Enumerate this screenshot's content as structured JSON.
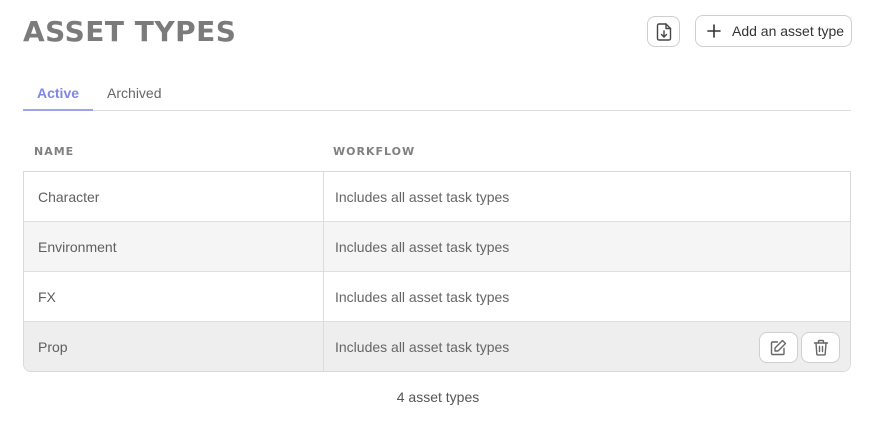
{
  "page": {
    "title": "ASSET TYPES",
    "add_button_label": "Add an asset type",
    "icons": {
      "download": "download-icon",
      "add": "plus-icon",
      "edit": "edit-icon",
      "delete": "trash-icon"
    }
  },
  "tabs": [
    {
      "label": "Active",
      "active": true
    },
    {
      "label": "Archived",
      "active": false
    }
  ],
  "table": {
    "columns": [
      "NAME",
      "WORKFLOW"
    ],
    "rows": [
      {
        "name": "Character",
        "workflow": "Includes all asset task types"
      },
      {
        "name": "Environment",
        "workflow": "Includes all asset task types"
      },
      {
        "name": "FX",
        "workflow": "Includes all asset task types"
      },
      {
        "name": "Prop",
        "workflow": "Includes all asset task types"
      }
    ]
  },
  "footer": {
    "count_text": "4 asset types"
  },
  "colors": {
    "accent": "#7f86e6",
    "title": "#7b7b7b",
    "row_alt": "#f5f5f5"
  }
}
